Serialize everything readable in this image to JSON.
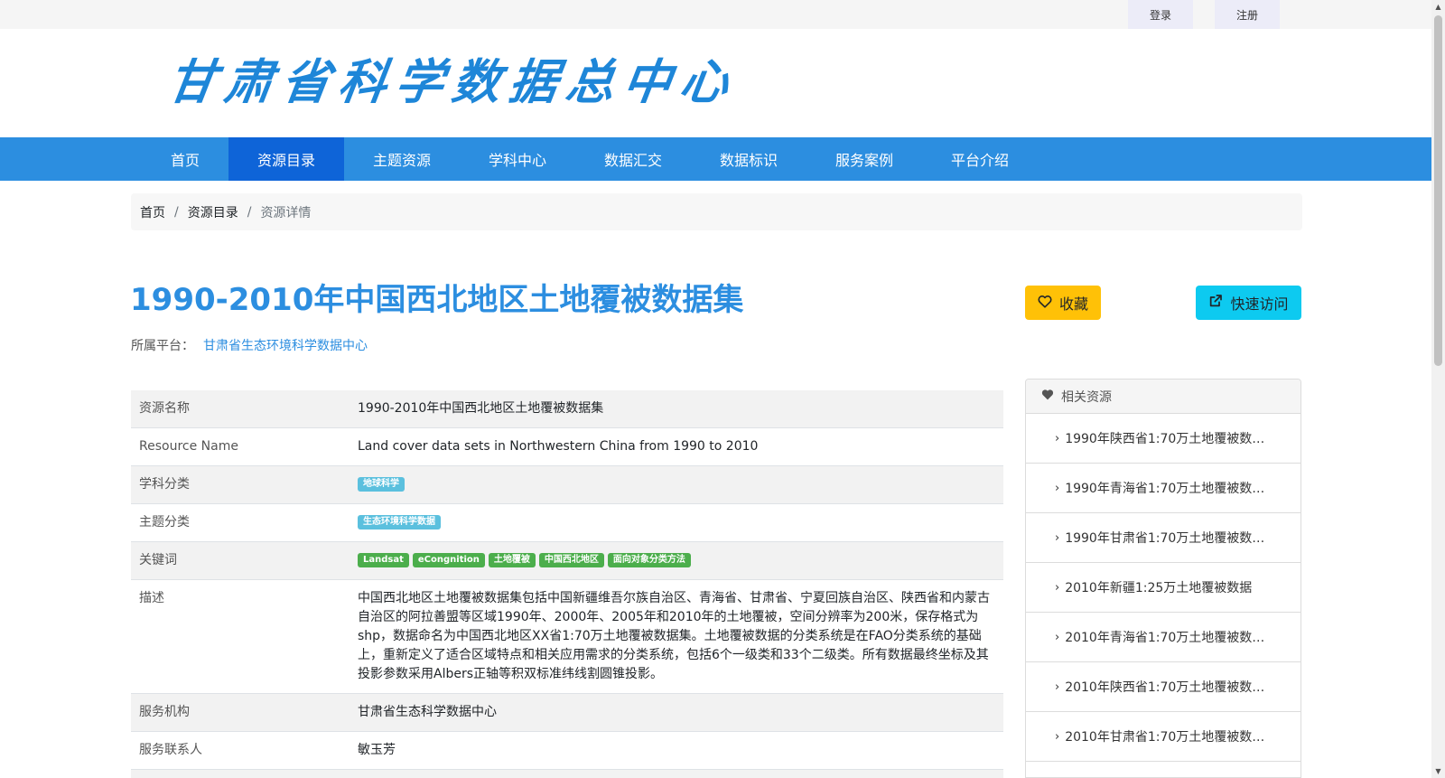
{
  "topbar": {
    "login": "登录",
    "register": "注册"
  },
  "header": {
    "logo_text": "甘肃省科学数据总中心"
  },
  "nav": {
    "items": [
      {
        "label": "首页"
      },
      {
        "label": "资源目录"
      },
      {
        "label": "主题资源"
      },
      {
        "label": "学科中心"
      },
      {
        "label": "数据汇交"
      },
      {
        "label": "数据标识"
      },
      {
        "label": "服务案例"
      },
      {
        "label": "平台介绍"
      }
    ],
    "active": "资源目录"
  },
  "breadcrumb": {
    "home": "首页",
    "catalog": "资源目录",
    "current": "资源详情",
    "separator": "/"
  },
  "resource": {
    "title": "1990-2010年中国西北地区土地覆被数据集",
    "platform_label": "所属平台：",
    "platform_value": "甘肃省生态环境科学数据中心"
  },
  "actions": {
    "favorite": "收藏",
    "quick_visit": "快速访问"
  },
  "details": {
    "name_label": "资源名称",
    "name_value": "1990-2010年中国西北地区土地覆被数据集",
    "en_label": "Resource Name",
    "en_value": "Land cover data sets in Northwestern China from 1990 to 2010",
    "subject_label": "学科分类",
    "subject_tags": [
      "地球科学"
    ],
    "theme_label": "主题分类",
    "theme_tags": [
      "生态环境科学数据"
    ],
    "keywords_label": "关键词",
    "keywords": [
      "Landsat",
      "eCongnition",
      "土地覆被",
      "中国西北地区",
      "面向对象分类方法"
    ],
    "desc_label": "描述",
    "desc_value": "中国西北地区土地覆被数据集包括中国新疆维吾尔族自治区、青海省、甘肃省、宁夏回族自治区、陕西省和内蒙古自治区的阿拉善盟等区域1990年、2000年、2005年和2010年的土地覆被，空间分辨率为200米，保存格式为shp，数据命名为中国西北地区XX省1:70万土地覆被数据集。土地覆被数据的分类系统是在FAO分类系统的基础上，重新定义了适合区域特点和相关应用需求的分类系统，包括6个一级类和33个二级类。所有数据最终坐标及其投影参数采用Albers正轴等积双标准纬线割圆锥投影。",
    "org_label": "服务机构",
    "org_value": "甘肃省生态科学数据中心",
    "contact_label": "服务联系人",
    "contact_value": "敏玉芳"
  },
  "related": {
    "title": "相关资源",
    "items": [
      "1990年陕西省1:70万土地覆被数…",
      "1990年青海省1:70万土地覆被数…",
      "1990年甘肃省1:70万土地覆被数…",
      "2010年新疆1:25万土地覆被数据",
      "2010年青海省1:70万土地覆被数…",
      "2010年陕西省1:70万土地覆被数…",
      "2010年甘肃省1:70万土地覆被数…"
    ]
  },
  "colors": {
    "brand_blue": "#2c8ee0",
    "nav_active": "#0e64d8",
    "favorite_yellow": "#ffc107",
    "visit_cyan": "#0dcaf0",
    "tag_blue": "#5bc0de",
    "tag_green": "#4cae4c"
  },
  "icons": {
    "favorite": "heart-outline-icon",
    "quick_visit": "external-link-icon",
    "related": "heart-icon",
    "related_item": "chevron-right-icon"
  }
}
